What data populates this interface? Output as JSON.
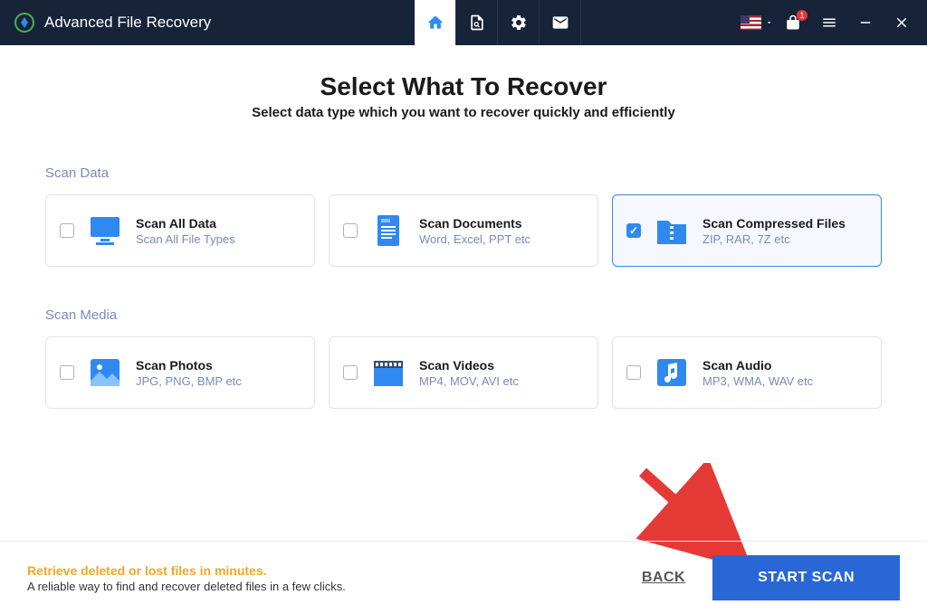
{
  "app": {
    "title": "Advanced File Recovery"
  },
  "titlebar": {
    "flag_locale": "US",
    "notification_count": "1"
  },
  "page": {
    "heading": "Select What To Recover",
    "subheading": "Select data type which you want to recover quickly and efficiently"
  },
  "sections": {
    "data": {
      "label": "Scan Data"
    },
    "media": {
      "label": "Scan Media"
    }
  },
  "cards": {
    "all": {
      "title": "Scan All Data",
      "desc": "Scan All File Types",
      "checked": false
    },
    "docs": {
      "title": "Scan Documents",
      "desc": "Word, Excel, PPT etc",
      "checked": false
    },
    "compressed": {
      "title": "Scan Compressed Files",
      "desc": "ZIP, RAR, 7Z etc",
      "checked": true
    },
    "photos": {
      "title": "Scan Photos",
      "desc": "JPG, PNG, BMP etc",
      "checked": false
    },
    "videos": {
      "title": "Scan Videos",
      "desc": "MP4, MOV, AVI etc",
      "checked": false
    },
    "audio": {
      "title": "Scan Audio",
      "desc": "MP3, WMA, WAV etc",
      "checked": false
    }
  },
  "footer": {
    "line1": "Retrieve deleted or lost files in minutes.",
    "line2": "A reliable way to find and recover deleted files in a few clicks.",
    "back": "BACK",
    "start": "START SCAN"
  }
}
